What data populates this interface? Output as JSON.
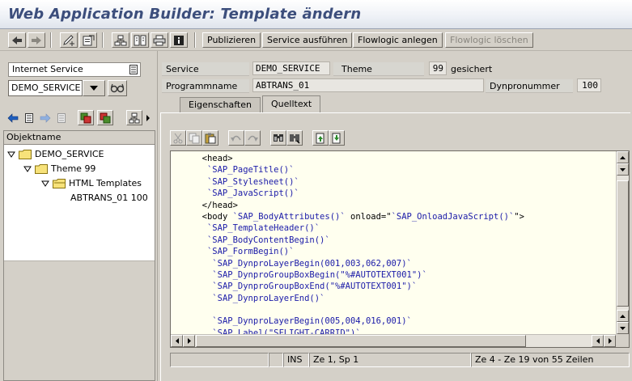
{
  "window": {
    "title": "Web Application Builder: Template ändern"
  },
  "toolbar": {
    "icons": [
      "back-arrow-icon",
      "forward-arrow-icon",
      "change-pencil-icon",
      "activate-icon",
      "hierarchy-icon",
      "object-list-icon",
      "print-icon",
      "info-icon"
    ],
    "buttons": [
      {
        "label": "Publizieren",
        "enabled": true
      },
      {
        "label": "Service ausführen",
        "enabled": true
      },
      {
        "label": "Flowlogic anlegen",
        "enabled": true
      },
      {
        "label": "Flowlogic löschen",
        "enabled": false
      }
    ]
  },
  "navigator": {
    "object_type": "Internet Service",
    "object_name": "DEMO_SERVICE",
    "tree_header": "Objektname",
    "tree": [
      {
        "label": "DEMO_SERVICE",
        "level": 0,
        "type": "folder"
      },
      {
        "label": "Theme 99",
        "level": 1,
        "type": "folder"
      },
      {
        "label": "HTML Templates",
        "level": 2,
        "type": "folder"
      },
      {
        "label": "ABTRANS_01 100",
        "level": 3,
        "type": "item"
      }
    ]
  },
  "header": {
    "service_label": "Service",
    "service_value": "DEMO_SERVICE",
    "theme_label": "Theme",
    "theme_value": "99",
    "theme_status": "gesichert",
    "program_label": "Programmname",
    "program_value": "ABTRANS_01",
    "dynpro_label": "Dynpronummer",
    "dynpro_value": "100"
  },
  "tabs": [
    {
      "label": "Eigenschaften",
      "active": false
    },
    {
      "label": "Quelltext",
      "active": true
    }
  ],
  "editor": {
    "lines": [
      {
        "indent": 2,
        "text": "<head>",
        "kind": "html"
      },
      {
        "indent": 3,
        "text": "`SAP_PageTitle()`",
        "kind": "sap"
      },
      {
        "indent": 3,
        "text": "`SAP_Stylesheet()`",
        "kind": "sap"
      },
      {
        "indent": 3,
        "text": "`SAP_JavaScript()`",
        "kind": "sap"
      },
      {
        "indent": 2,
        "text": "</head>",
        "kind": "html"
      },
      {
        "indent": 2,
        "text": "<body ",
        "kind": "html",
        "rest": [
          {
            "text": "`SAP_BodyAttributes()`",
            "kind": "sap"
          },
          {
            "text": " onload=\"",
            "kind": "html"
          },
          {
            "text": "`SAP_OnloadJavaScript()`",
            "kind": "sap"
          },
          {
            "text": "\">",
            "kind": "html"
          }
        ]
      },
      {
        "indent": 3,
        "text": "`SAP_TemplateHeader()`",
        "kind": "sap"
      },
      {
        "indent": 3,
        "text": "`SAP_BodyContentBegin()`",
        "kind": "sap"
      },
      {
        "indent": 3,
        "text": "`SAP_FormBegin()`",
        "kind": "sap"
      },
      {
        "indent": 4,
        "text": "`SAP_DynproLayerBegin(001,003,062,007)`",
        "kind": "sap"
      },
      {
        "indent": 4,
        "text": "`SAP_DynproGroupBoxBegin(\"%#AUTOTEXT001\")`",
        "kind": "sap"
      },
      {
        "indent": 4,
        "text": "`SAP_DynproGroupBoxEnd(\"%#AUTOTEXT001\")`",
        "kind": "sap"
      },
      {
        "indent": 4,
        "text": "`SAP_DynproLayerEnd()`",
        "kind": "sap"
      },
      {
        "indent": 4,
        "text": "",
        "kind": "html"
      },
      {
        "indent": 4,
        "text": "`SAP_DynproLayerBegin(005,004,016,001)`",
        "kind": "sap"
      },
      {
        "indent": 4,
        "text": "`SAP_Label(\"SFLIGHT-CARRID\")`",
        "kind": "sap"
      }
    ]
  },
  "statusbar": {
    "mode": "INS",
    "cursor": "Ze 1, Sp 1",
    "range": "Ze 4 - Ze 19 von 55 Zeilen"
  }
}
